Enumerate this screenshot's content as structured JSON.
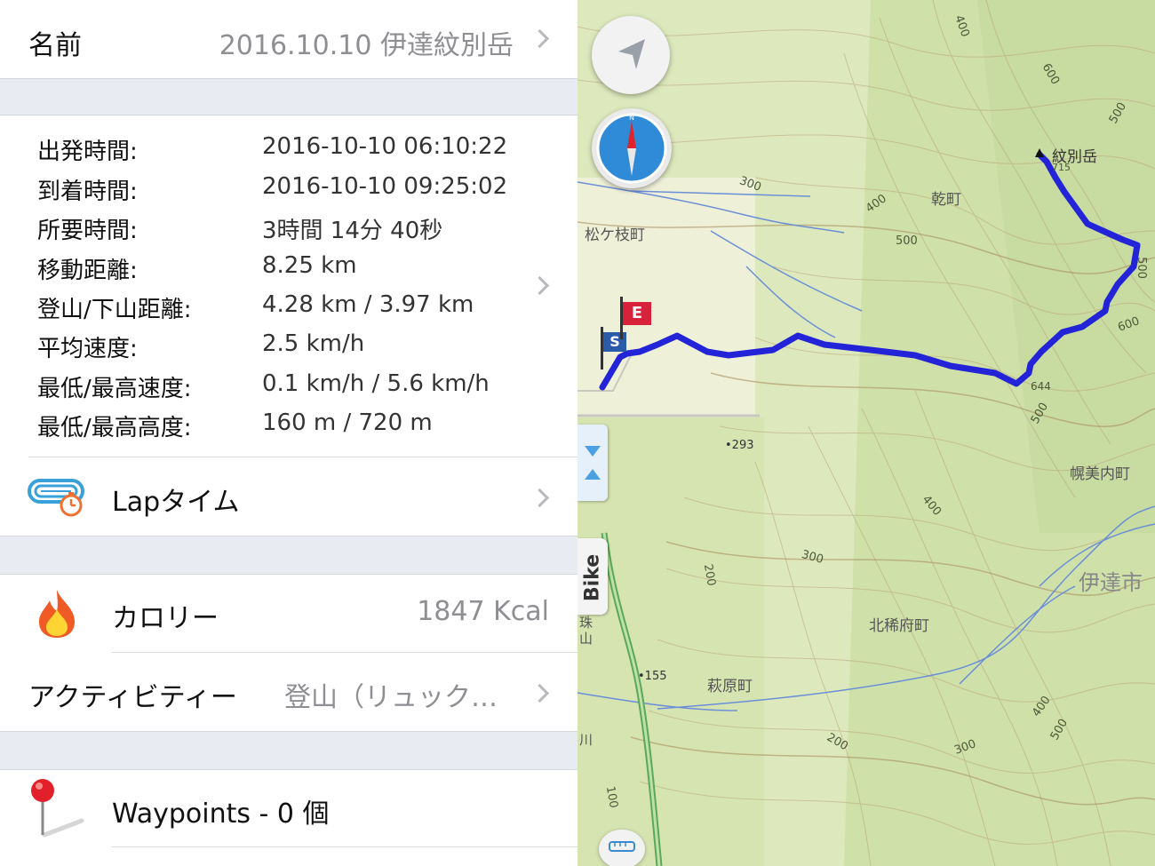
{
  "name_row": {
    "label": "名前",
    "value": "2016.10.10 伊達紋別岳"
  },
  "stats": [
    {
      "label": "出発時間:",
      "value": "2016-10-10 06:10:22"
    },
    {
      "label": "到着時間:",
      "value": "2016-10-10 09:25:02"
    },
    {
      "label": "所要時間:",
      "value": "3時間 14分 40秒"
    },
    {
      "label": "移動距離:",
      "value": "8.25 km"
    },
    {
      "label": "登山/下山距離:",
      "value": "4.28 km / 3.97 km"
    },
    {
      "label": "平均速度:",
      "value": "2.5 km/h"
    },
    {
      "label": "最低/最高速度:",
      "value": "0.1 km/h / 5.6 km/h"
    },
    {
      "label": "最低/最高高度:",
      "value": "160 m / 720 m"
    }
  ],
  "lap_row": {
    "label": "Lapタイム",
    "icon": "stopwatch-track-icon"
  },
  "calorie_row": {
    "label": "カロリー",
    "value": "1847 Kcal",
    "icon": "flame-icon"
  },
  "activity_row": {
    "label": "アクティビティー",
    "value": "登山（リュック…"
  },
  "waypoints_row": {
    "label": "Waypoints - 0 個",
    "icon": "pin-icon"
  },
  "map": {
    "bike_tab": "Bike",
    "start_flag": "S",
    "end_flag": "E",
    "track_color": "#2323d8",
    "places": {
      "summit": "紋別岳",
      "inui": "乾町",
      "matsugae": "松ケ枝町",
      "horobinai": "幌美内町",
      "date_city": "伊達市",
      "kitamarefu": "北稀府町",
      "hagiwara": "萩原町",
      "shu": "珠",
      "yama": "山",
      "kawa": "川"
    },
    "heights": {
      "summit": "715",
      "p644": "644",
      "p293": "•293",
      "p155": "•155"
    },
    "contours": [
      "400",
      "600",
      "500",
      "300",
      "400",
      "500",
      "500",
      "600",
      "500",
      "400",
      "300",
      "200",
      "400",
      "200",
      "300",
      "500",
      "100"
    ]
  }
}
